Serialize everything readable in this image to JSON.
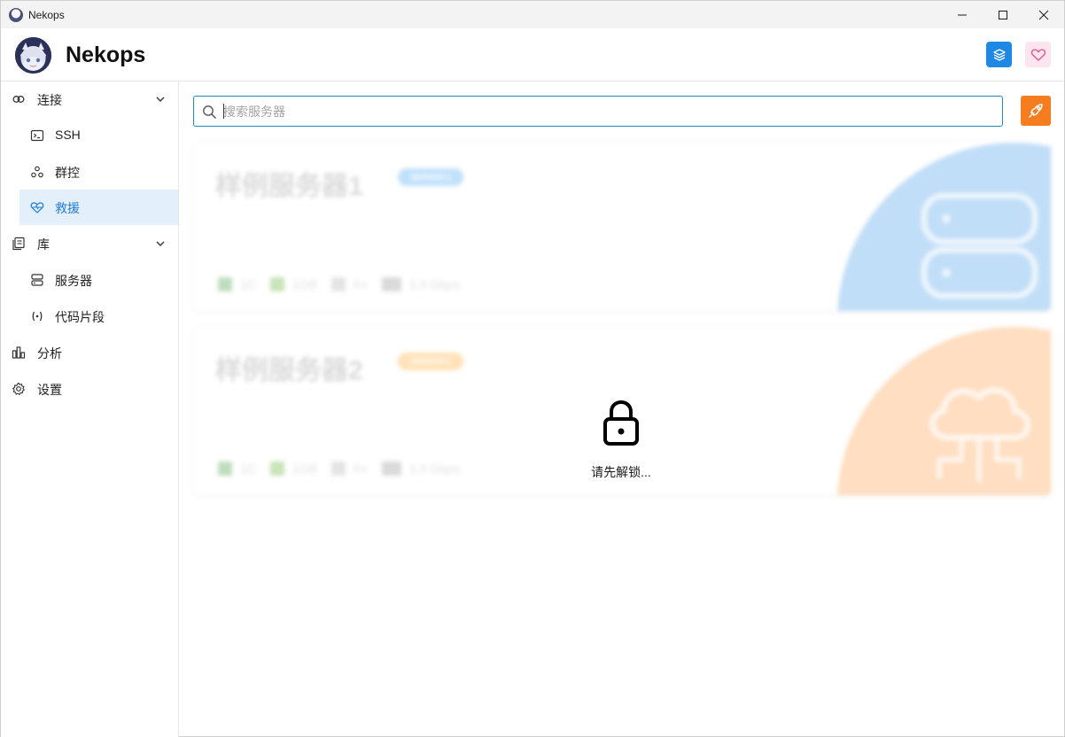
{
  "window": {
    "title": "Nekops"
  },
  "header": {
    "brand": "Nekops"
  },
  "sidebar": {
    "groups": [
      {
        "label": "连接"
      },
      {
        "label": "库"
      },
      {
        "label": "分析"
      },
      {
        "label": "设置"
      }
    ],
    "items": [
      {
        "label": "SSH"
      },
      {
        "label": "群控"
      },
      {
        "label": "救援",
        "active": true
      },
      {
        "label": "服务器"
      },
      {
        "label": "代码片段"
      }
    ]
  },
  "search": {
    "placeholder": "搜索服务器",
    "value": ""
  },
  "servers": [
    {
      "name": "样例服务器1",
      "tag": "SERVER-1",
      "tag_color": "#90caf9",
      "accent": "#90c4f3",
      "cpu": "1C",
      "mem": "1GB",
      "disk": "0+",
      "net": "1.0 Gbps"
    },
    {
      "name": "样例服务器2",
      "tag": "SERVER-2",
      "tag_color": "#ffcc80",
      "accent": "#ffc48f",
      "cpu": "1C",
      "mem": "1GB",
      "disk": "0+",
      "net": "1.0 Gbps"
    }
  ],
  "lock": {
    "message": "请先解锁..."
  },
  "colors": {
    "primary": "#1e88e5",
    "rocket": "#f57c1f",
    "heart_bg": "#fde4ee",
    "active_bg": "#e3effb"
  }
}
